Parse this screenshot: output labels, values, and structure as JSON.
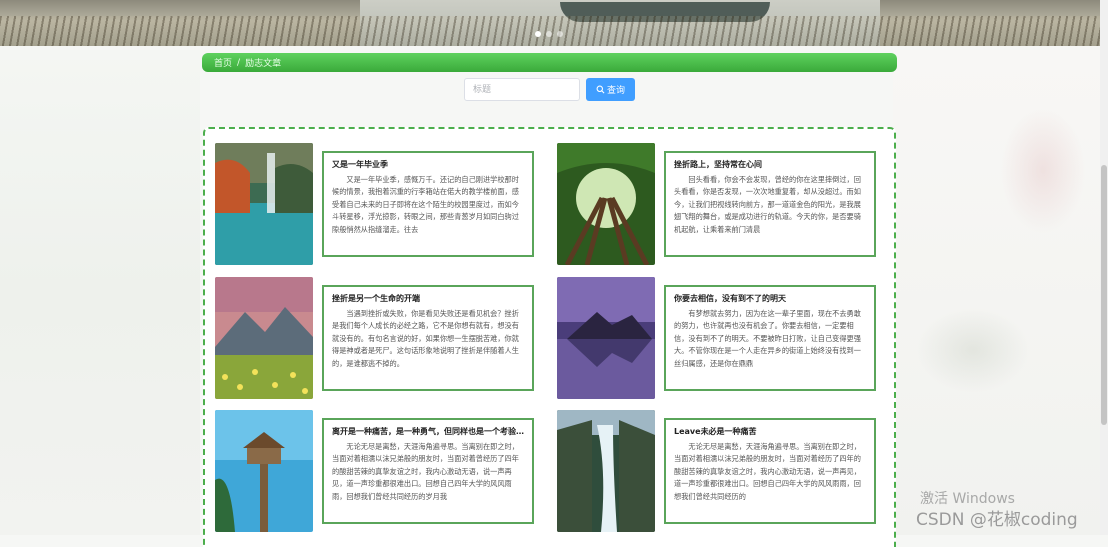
{
  "carousel": {
    "slide_count": 3,
    "active_index": 0
  },
  "breadcrumb": {
    "home": "首页",
    "separator": "/",
    "current": "励志文章"
  },
  "search": {
    "placeholder": "标题",
    "button_label": "查询"
  },
  "articles": [
    {
      "title": "又是一年毕业季",
      "body": "又是一年毕业季，感慨万千。还记的自己刚进学校那时候的情景，我抱着沉重的行李箱站在偌大的教学楼前面，感受着自己未来的日子即将在这个陌生的校园里度过，而如今斗转星移，浮光掠影，转眼之间，那些青葱岁月如同白驹过隙般悄然从指缝溜走。往去",
      "image": "waterfall-lake-photo"
    },
    {
      "title": "挫折路上，坚持常在心间",
      "body": "回头看看，你会不会发现，曾经的你在这里摔倒过，回头看看，你是否发现，一次次地重复着，却从没超过。而如今，让我们把视线转向前方，那一道道金色的阳光，是我展翅飞翔的舞台，或是成功进行的轨道。今天的你，是否要骑机起航，让乘着来前门清晨",
      "image": "forest-canopy-photo"
    },
    {
      "title": "挫折是另一个生命的开端",
      "body": "当遇到挫折或失败，你是看见失败还是看见机会？挫折是我们每个人成长的必经之路，它不是你想有就有，想没有就没有的。有句名言说的好，如果你想一生摆脱苦难，你就得是神或者是死尸。这句话形象地说明了挫折是伴随着人生的，是谁都逃不掉的。",
      "image": "mountain-flowers-photo"
    },
    {
      "title": "你要去相信，没有到不了的明天",
      "body": "有梦想就去努力，因为在这一辈子里面，现在不去勇敢的努力，也许就再也没有机会了。你要去相信，一定要相信，没有到不了的明天。不要被昨日打败，让自己变得更强大。不管你现在是一个人走在异乡的街道上始终没有找到一丝归属感，还是你在鼎鼎",
      "image": "lake-mountain-sunset-photo"
    },
    {
      "title": "离开是一种痛苦，是一种勇气，但同样也是一个考验...",
      "body": "无论无尽是离愁，天涯海角遍寻思。当离别在即之时，当面对着相濡以沫兄弟般的朋友时，当面对着曾经历了四年的酸甜苦辣的真挚友谊之时，我内心激动无语，说一声再见，道一声珍重都很难出口。回想自己四年大学的风风雨雨，回想我们曾经共同经历的岁月我",
      "image": "overwater-hut-photo"
    },
    {
      "title": "Leave未必是一种痛苦",
      "body": "无论无尽是离愁，天涯海角遍寻思。当离别在即之时，当面对着相濡以沫兄弟般的朋友时，当面对着经历了四年的酸甜苦辣的真挚友谊之时，我内心激动无语，说一声再见，道一声珍重都很难出口。回想自己四年大学的风风雨雨，回想我们曾经共同经历的",
      "image": "waterfall-cliff-photo"
    }
  ],
  "watermark": {
    "windows": "激活 Windows",
    "csdn": "CSDN @花椒coding"
  }
}
